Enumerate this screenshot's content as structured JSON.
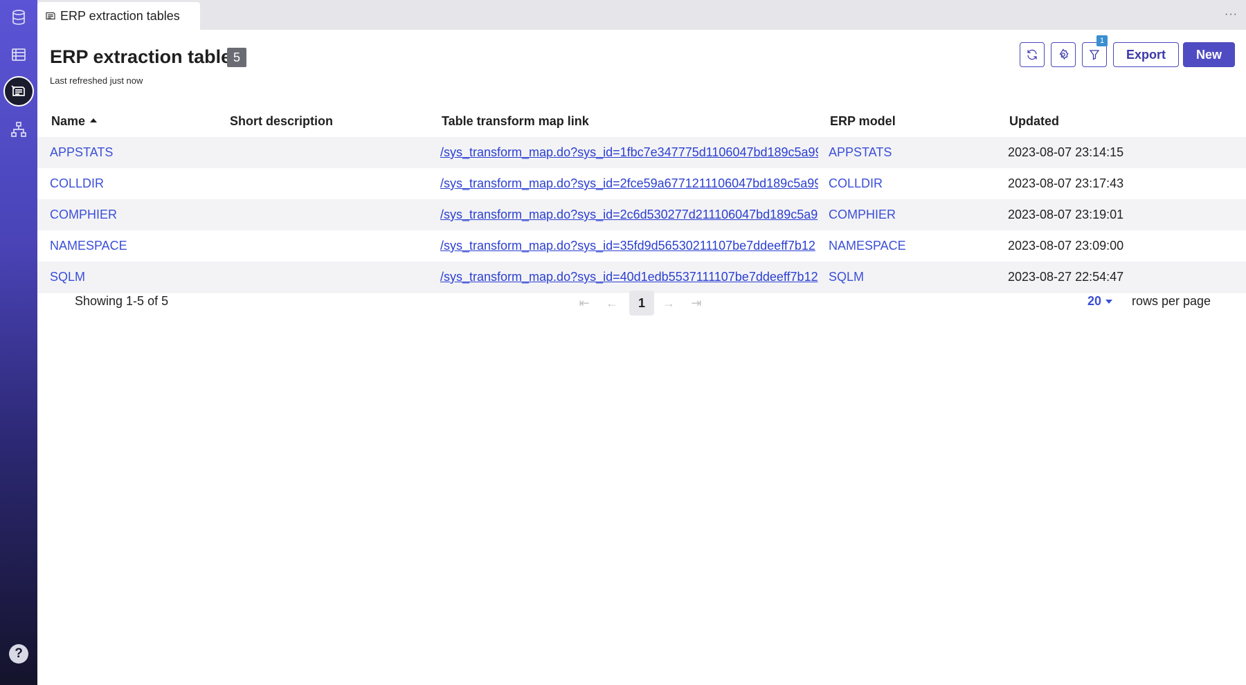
{
  "sidebar": {
    "items": [
      {
        "icon": "database-icon"
      },
      {
        "icon": "table-icon"
      },
      {
        "icon": "erp-extraction-icon",
        "active": true
      },
      {
        "icon": "hierarchy-icon"
      }
    ],
    "help_label": "?"
  },
  "tabbar": {
    "tab_label": "ERP extraction tables",
    "more_label": "···"
  },
  "header": {
    "title": "ERP extraction tables",
    "count": "5",
    "refreshed": "Last refreshed just now",
    "filter_count": "1",
    "export_label": "Export",
    "new_label": "New"
  },
  "table": {
    "columns": [
      "Name",
      "Short description",
      "Table transform map link",
      "ERP model",
      "Updated"
    ],
    "rows": [
      {
        "name": "APPSTATS",
        "description": "",
        "link": "/sys_transform_map.do?sys_id=1fbc7e347775d1106047bd189c5a99",
        "model": "APPSTATS",
        "updated": "2023-08-07 23:14:15"
      },
      {
        "name": "COLLDIR",
        "description": "",
        "link": "/sys_transform_map.do?sys_id=2fce59a6771211106047bd189c5a99",
        "model": "COLLDIR",
        "updated": "2023-08-07 23:17:43"
      },
      {
        "name": "COMPHIER",
        "description": "",
        "link": "/sys_transform_map.do?sys_id=2c6d530277d211106047bd189c5a9",
        "model": "COMPHIER",
        "updated": "2023-08-07 23:19:01"
      },
      {
        "name": "NAMESPACE",
        "description": "",
        "link": "/sys_transform_map.do?sys_id=35fd9d56530211107be7ddeeff7b12",
        "model": "NAMESPACE",
        "updated": "2023-08-07 23:09:00"
      },
      {
        "name": "SQLM",
        "description": "",
        "link": "/sys_transform_map.do?sys_id=40d1edb5537111107be7ddeeff7b12",
        "model": "SQLM",
        "updated": "2023-08-27 22:54:47"
      }
    ]
  },
  "pagination": {
    "showing": "Showing 1-5 of 5",
    "current_page": "1",
    "rows_per_page_value": "20",
    "rows_per_page_label": "rows per page"
  },
  "colors": {
    "accent": "#4f4cc3",
    "link": "#3b4fd6",
    "badge": "#6b6b73"
  }
}
